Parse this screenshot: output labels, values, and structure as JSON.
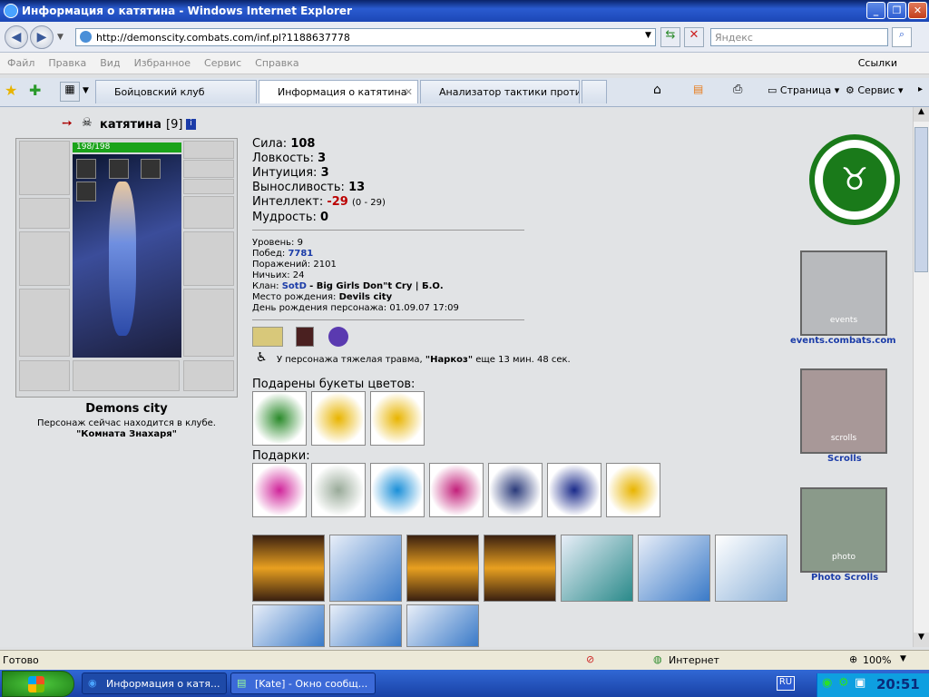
{
  "window": {
    "title": "Информация о катятина - Windows Internet Explorer"
  },
  "nav": {
    "url": "http://demonscity.combats.com/inf.pl?1188637778",
    "search_placeholder": "Яндекс"
  },
  "menu": {
    "items": [
      "Файл",
      "Правка",
      "Вид",
      "Избранное",
      "Сервис",
      "Справка"
    ],
    "links": "Ссылки"
  },
  "tabs": [
    {
      "label": "Бойцовский клуб"
    },
    {
      "label": "Информация о катятина"
    },
    {
      "label": "Анализатор тактики проти..."
    }
  ],
  "toolbar": {
    "page": "Страница",
    "service": "Сервис"
  },
  "character": {
    "name": "катятина",
    "level": "[9]",
    "hp": "198/198",
    "city": "Demons city",
    "location_text": "Персонаж сейчас находится в клубе.",
    "location": "\"Комната Знахаря\""
  },
  "stats": {
    "strength_label": "Сила:",
    "strength": "108",
    "agility_label": "Ловкость:",
    "agility": "3",
    "intuition_label": "Интуиция:",
    "intuition": "3",
    "endurance_label": "Выносливость:",
    "endurance": "13",
    "intellect_label": "Интеллект:",
    "intellect": "-29",
    "intellect_note": "(0 - 29)",
    "wisdom_label": "Мудрость:",
    "wisdom": "0"
  },
  "info": {
    "level": "Уровень: 9",
    "wins_label": "Побед:",
    "wins": "7781",
    "losses": "Поражений: 2101",
    "draws": "Ничьих: 24",
    "clan_label": "Клан:",
    "clan": "SotD",
    "clan_rest": "- Big Girls Don\"t Cry | Б.О.",
    "birthplace_label": "Место рождения:",
    "birthplace": "Devils city",
    "birthday": "День рождения персонажа: 01.09.07 17:09"
  },
  "trauma": {
    "prefix": "У персонажа тяжелая травма,",
    "name": "\"Наркоз\"",
    "suffix": "еще 13 мин. 48 сек."
  },
  "sections": {
    "bouquets": "Подарены букеты цветов:",
    "gifts": "Подарки:"
  },
  "side": {
    "events": "events.combats.com",
    "scrolls": "Scrolls",
    "photo": "Photo Scrolls",
    "banner_events": "events",
    "banner_scrolls": "scrolls",
    "banner_photo": "photo"
  },
  "statusbar": {
    "ready": "Готово",
    "zone": "Интернет",
    "zoom": "100%"
  },
  "taskbar": {
    "task1": "Информация о катя...",
    "task2": "[Kate] - Окно сообщ...",
    "lang": "RU",
    "time": "20:51"
  }
}
